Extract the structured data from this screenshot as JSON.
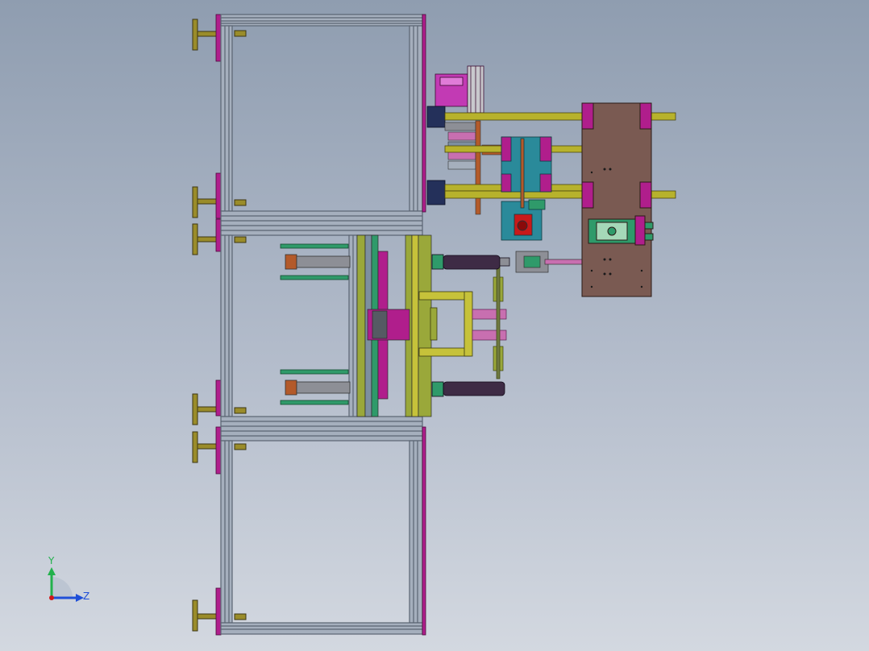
{
  "viewport": {
    "background_top": "#8f9db0",
    "background_bottom": "#d3d8e0"
  },
  "triad": {
    "y_label": "Y",
    "z_label": "Z",
    "y_color": "#22b14c",
    "z_color": "#1f4fd8",
    "x_color": "#d01818"
  },
  "colors": {
    "frame_line": "#5a6472",
    "frame_fill": "#9aa5b4",
    "plate_magenta": "#b01e8c",
    "pipe_yellow": "#b7b22c",
    "plate_brown": "#7a5a52",
    "plate_teal": "#2a8a9a",
    "cylinder_dark": "#3e2b45",
    "green_rod": "#2f9a6a",
    "olive": "#9aa83a",
    "pink": "#c86fb0",
    "red": "#c81a1a",
    "foot_yellow": "#9a8c2a"
  }
}
